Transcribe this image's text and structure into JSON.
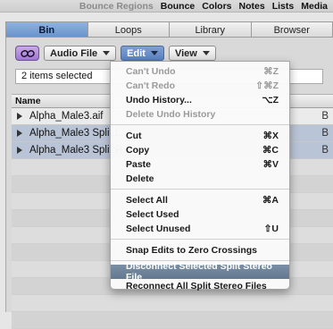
{
  "topbar": {
    "items": [
      {
        "label": "Bounce Regions",
        "dim": true
      },
      {
        "label": "Bounce",
        "dim": false
      },
      {
        "label": "Colors",
        "dim": false
      },
      {
        "label": "Notes",
        "dim": false
      },
      {
        "label": "Lists",
        "dim": false
      },
      {
        "label": "Media",
        "dim": false
      }
    ]
  },
  "tabs": [
    {
      "label": "Bin",
      "active": true
    },
    {
      "label": "Loops",
      "active": false
    },
    {
      "label": "Library",
      "active": false
    },
    {
      "label": "Browser",
      "active": false
    }
  ],
  "toolbar": {
    "link_icon": "link-icon",
    "audio_file": "Audio File",
    "edit": "Edit",
    "view": "View"
  },
  "status": {
    "text": "2 items selected"
  },
  "list": {
    "header": "Name",
    "rows": [
      {
        "name": "Alpha_Male3.aif",
        "tail": "B",
        "selected": false
      },
      {
        "name": "Alpha_Male3 Split.L",
        "tail": "B",
        "selected": true
      },
      {
        "name": "Alpha_Male3 Split.R",
        "tail": "B",
        "selected": true
      }
    ]
  },
  "edit_menu": {
    "groups": [
      [
        {
          "label": "Can't Undo",
          "shortcut": "⌘Z",
          "disabled": true
        },
        {
          "label": "Can't Redo",
          "shortcut": "⇧⌘Z",
          "disabled": true
        },
        {
          "label": "Undo History...",
          "shortcut": "⌥Z",
          "disabled": false
        },
        {
          "label": "Delete Undo History",
          "shortcut": "",
          "disabled": true
        }
      ],
      [
        {
          "label": "Cut",
          "shortcut": "⌘X",
          "disabled": false
        },
        {
          "label": "Copy",
          "shortcut": "⌘C",
          "disabled": false
        },
        {
          "label": "Paste",
          "shortcut": "⌘V",
          "disabled": false
        },
        {
          "label": "Delete",
          "shortcut": "",
          "disabled": false
        }
      ],
      [
        {
          "label": "Select All",
          "shortcut": "⌘A",
          "disabled": false
        },
        {
          "label": "Select Used",
          "shortcut": "",
          "disabled": false
        },
        {
          "label": "Select Unused",
          "shortcut": "⇧U",
          "disabled": false
        }
      ],
      [
        {
          "label": "Snap Edits to Zero Crossings",
          "shortcut": "",
          "disabled": false
        }
      ],
      [
        {
          "label": "Disconnect Selected Split Stereo File",
          "shortcut": "",
          "disabled": false,
          "highlighted": true
        },
        {
          "label": "Reconnect All Split Stereo Files",
          "shortcut": "",
          "disabled": false
        }
      ]
    ]
  }
}
